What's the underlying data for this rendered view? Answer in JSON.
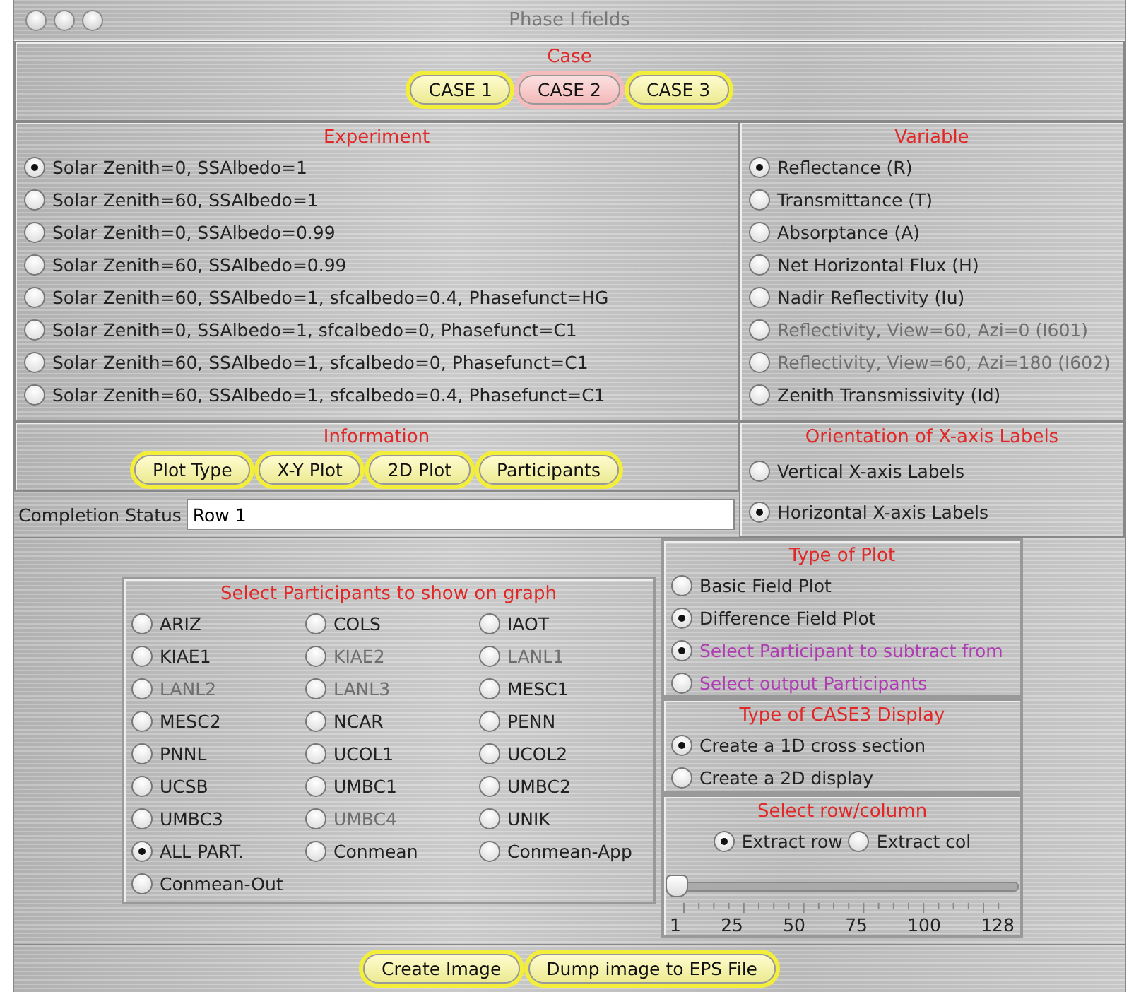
{
  "window": {
    "title": "Phase I fields"
  },
  "case": {
    "heading": "Case",
    "buttons": [
      {
        "label": "CASE 1",
        "selected": false
      },
      {
        "label": "CASE 2",
        "selected": true
      },
      {
        "label": "CASE 3",
        "selected": false
      }
    ]
  },
  "experiment": {
    "heading": "Experiment",
    "options": [
      {
        "label": "Solar Zenith=0, SSAlbedo=1",
        "selected": true
      },
      {
        "label": "Solar Zenith=60, SSAlbedo=1",
        "selected": false
      },
      {
        "label": "Solar Zenith=0, SSAlbedo=0.99",
        "selected": false
      },
      {
        "label": "Solar Zenith=60, SSAlbedo=0.99",
        "selected": false
      },
      {
        "label": "Solar Zenith=60, SSAlbedo=1, sfcalbedo=0.4, Phasefunct=HG",
        "selected": false
      },
      {
        "label": "Solar Zenith=0, SSAlbedo=1, sfcalbedo=0, Phasefunct=C1",
        "selected": false
      },
      {
        "label": "Solar Zenith=60, SSAlbedo=1, sfcalbedo=0, Phasefunct=C1",
        "selected": false
      },
      {
        "label": "Solar Zenith=60, SSAlbedo=1, sfcalbedo=0.4, Phasefunct=C1",
        "selected": false
      }
    ]
  },
  "variable": {
    "heading": "Variable",
    "options": [
      {
        "label": "Reflectance (R)",
        "selected": true,
        "disabled": false
      },
      {
        "label": "Transmittance (T)",
        "selected": false,
        "disabled": false
      },
      {
        "label": "Absorptance (A)",
        "selected": false,
        "disabled": false
      },
      {
        "label": "Net Horizontal Flux (H)",
        "selected": false,
        "disabled": false
      },
      {
        "label": "Nadir Reflectivity (Iu)",
        "selected": false,
        "disabled": false
      },
      {
        "label": "Reflectivity, View=60, Azi=0 (I601)",
        "selected": false,
        "disabled": true
      },
      {
        "label": "Reflectivity, View=60, Azi=180 (I602)",
        "selected": false,
        "disabled": true
      },
      {
        "label": "Zenith Transmissivity (Id)",
        "selected": false,
        "disabled": false
      }
    ]
  },
  "information": {
    "heading": "Information",
    "buttons": [
      "Plot Type",
      "X-Y Plot",
      "2D Plot",
      "Participants"
    ]
  },
  "orientation": {
    "heading": "Orientation of X-axis Labels",
    "options": [
      {
        "label": "Vertical X-axis Labels",
        "selected": false
      },
      {
        "label": "Horizontal X-axis Labels",
        "selected": true
      }
    ]
  },
  "completion_status": {
    "label": "Completion Status",
    "value": "Row 1"
  },
  "participants": {
    "heading": "Select Participants to show on graph",
    "options": [
      {
        "label": "ARIZ",
        "selected": false,
        "disabled": false
      },
      {
        "label": "COLS",
        "selected": false,
        "disabled": false
      },
      {
        "label": "IAOT",
        "selected": false,
        "disabled": false
      },
      {
        "label": "KIAE1",
        "selected": false,
        "disabled": false
      },
      {
        "label": "KIAE2",
        "selected": false,
        "disabled": true
      },
      {
        "label": "LANL1",
        "selected": false,
        "disabled": true
      },
      {
        "label": "LANL2",
        "selected": false,
        "disabled": true
      },
      {
        "label": "LANL3",
        "selected": false,
        "disabled": true
      },
      {
        "label": "MESC1",
        "selected": false,
        "disabled": false
      },
      {
        "label": "MESC2",
        "selected": false,
        "disabled": false
      },
      {
        "label": "NCAR",
        "selected": false,
        "disabled": false
      },
      {
        "label": "PENN",
        "selected": false,
        "disabled": false
      },
      {
        "label": "PNNL",
        "selected": false,
        "disabled": false
      },
      {
        "label": "UCOL1",
        "selected": false,
        "disabled": false
      },
      {
        "label": "UCOL2",
        "selected": false,
        "disabled": false
      },
      {
        "label": "UCSB",
        "selected": false,
        "disabled": false
      },
      {
        "label": "UMBC1",
        "selected": false,
        "disabled": false
      },
      {
        "label": "UMBC2",
        "selected": false,
        "disabled": false
      },
      {
        "label": "UMBC3",
        "selected": false,
        "disabled": false
      },
      {
        "label": "UMBC4",
        "selected": false,
        "disabled": true
      },
      {
        "label": "UNIK",
        "selected": false,
        "disabled": false
      },
      {
        "label": "ALL PART.",
        "selected": true,
        "disabled": false
      },
      {
        "label": "Conmean",
        "selected": false,
        "disabled": false
      },
      {
        "label": "Conmean-App",
        "selected": false,
        "disabled": false
      },
      {
        "label": "Conmean-Out",
        "selected": false,
        "disabled": false
      }
    ]
  },
  "plot_type": {
    "heading": "Type of Plot",
    "options": [
      {
        "label": "Basic Field Plot",
        "selected": false,
        "color": "#222222"
      },
      {
        "label": "Difference Field Plot",
        "selected": true,
        "color": "#222222"
      },
      {
        "label": "Select Participant to subtract from",
        "selected": true,
        "color": "#b03cb4"
      },
      {
        "label": "Select output Participants",
        "selected": false,
        "color": "#b03cb4"
      }
    ]
  },
  "case3_display": {
    "heading": "Type of CASE3 Display",
    "options": [
      {
        "label": "Create a 1D cross section",
        "selected": true
      },
      {
        "label": "Create a 2D display",
        "selected": false
      }
    ]
  },
  "row_column": {
    "heading": "Select row/column",
    "options": [
      {
        "label": "Extract row",
        "selected": true
      },
      {
        "label": "Extract col",
        "selected": false
      }
    ],
    "slider": {
      "level": 0,
      "ticks": [
        "1",
        "25",
        "50",
        "75",
        "100",
        "128"
      ]
    }
  },
  "actions": [
    "Create Image",
    "Dump image to EPS File"
  ]
}
